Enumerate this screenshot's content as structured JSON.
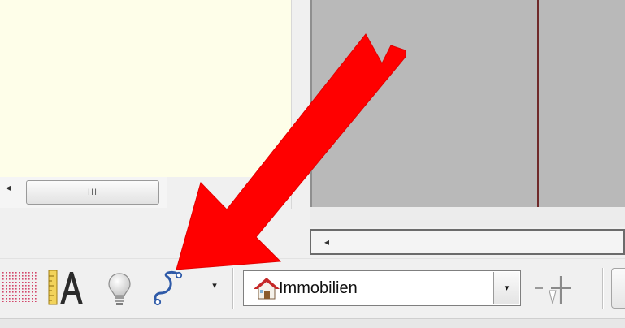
{
  "left_scrollbar": {
    "arrow_glyph": "◂",
    "thumb_grip": "III"
  },
  "right_scrollbar": {
    "arrow_glyph": "◂"
  },
  "toolbar": {
    "curve_dropdown_glyph": "▾",
    "layer_combo": {
      "selected": "Immobilien",
      "dropdown_glyph": "▾"
    }
  },
  "icons": [
    "grid-icon",
    "ruler-text-icon",
    "lightbulb-icon",
    "curve-icon",
    "house-icon",
    "connector-icon"
  ],
  "colors": {
    "left_pane_bg": "#fefee9",
    "right_pane_bg": "#b9b9b9",
    "annotation_arrow": "#ff0000"
  }
}
